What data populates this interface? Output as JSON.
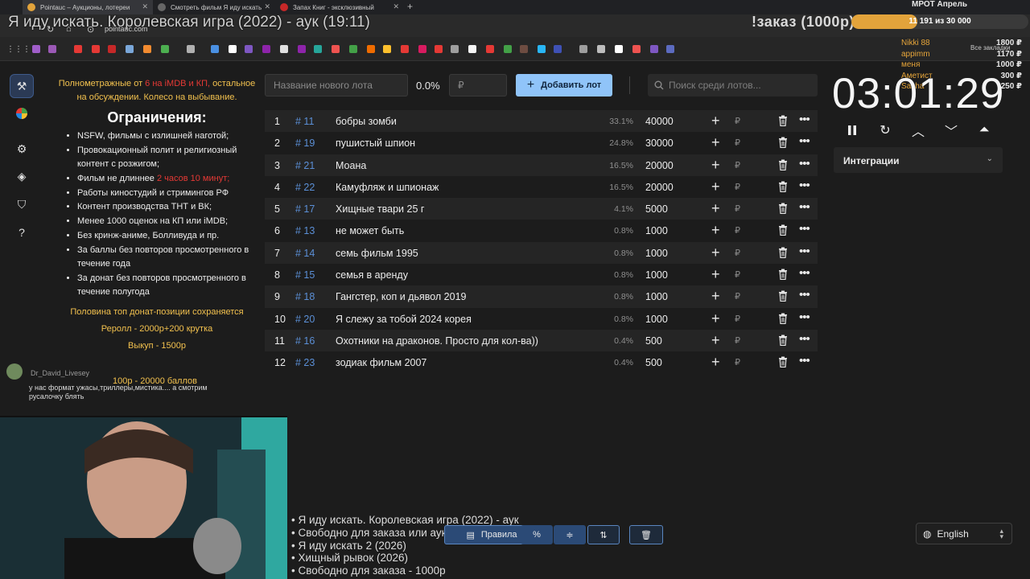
{
  "browser": {
    "tabs": [
      {
        "label": "Pointauc – Аукционы, лотереи",
        "favicon_color": "#e2a33b"
      },
      {
        "label": "Смотреть фильм Я иду искать",
        "favicon_color": "#666666"
      },
      {
        "label": "Запах Книг - эксклюзивный",
        "favicon_color": "#c62828"
      }
    ],
    "url": "pointauc.com",
    "all_bookmarks": "Все закладки"
  },
  "stream": {
    "title": "Я иду искать. Королевская игра (2022) - аук (19:11)",
    "order_label": "!заказ (1000р)",
    "goal_label": "МРОТ Апрель",
    "goal_text": "11 191  из 30 000",
    "goal_progress": 0.373,
    "donors": [
      {
        "name": "Nikki 88",
        "amount": "1800 ₽"
      },
      {
        "name": "appimm",
        "amount": "1170 ₽"
      },
      {
        "name": "меня",
        "amount": "1000 ₽"
      },
      {
        "name": "Аметист",
        "amount": "300 ₽"
      },
      {
        "name": "Sasha",
        "amount": "250 ₽"
      }
    ]
  },
  "info": {
    "intro_a": "Полнометражные от ",
    "intro_b": "6 на iMDB и КП,",
    "intro_c": " остальное на обсуждении. Колесо на выбывание.",
    "limits_title": "Ограничения:",
    "rules": [
      "NSFW, фильмы с излишней наготой;",
      "Провокационный полит и религиозный контент с розжигом;",
      "Фильм не длиннее ",
      "Работы киностудий и стримингов РФ",
      "Контент производства ТНТ и ВК;",
      "Менее 1000 оценок на КП или iMDB;",
      "Без кринж-аниме, Болливуда и пр.",
      "За баллы без повторов просмотренного в течение года",
      "За донат без повторов просмотренного в течение полугода"
    ],
    "rule_length_red": "2 часов 10 минут;",
    "notes": [
      "Половина топ донат-позиции сохраняется",
      "Реролл - 2000р+200 крутка",
      "Выкуп - 1500р"
    ],
    "bonus": "100р - 20000 баллов"
  },
  "chat": {
    "user": "Dr_David_Livesey",
    "message": "у нас формат ужасы,триллеры,мистика.... а смотрим русалочку блять"
  },
  "toolbar": {
    "new_lot_placeholder": "Название нового лота",
    "percent": "0.0%",
    "currency_placeholder": "₽",
    "add_label": "Добавить лот",
    "search_placeholder": "Поиск среди лотов..."
  },
  "lots": [
    {
      "idx": "1",
      "num": "# 11",
      "name": "бобры зомби",
      "pct": "33.1%",
      "amount": "40000"
    },
    {
      "idx": "2",
      "num": "# 19",
      "name": "пушистый шпион",
      "pct": "24.8%",
      "amount": "30000"
    },
    {
      "idx": "3",
      "num": "# 21",
      "name": "Моана",
      "pct": "16.5%",
      "amount": "20000"
    },
    {
      "idx": "4",
      "num": "# 22",
      "name": "Камуфляж и шпионаж",
      "pct": "16.5%",
      "amount": "20000"
    },
    {
      "idx": "5",
      "num": "# 17",
      "name": "Хищные твари 25 г",
      "pct": "4.1%",
      "amount": "5000"
    },
    {
      "idx": "6",
      "num": "# 13",
      "name": "не может быть",
      "pct": "0.8%",
      "amount": "1000"
    },
    {
      "idx": "7",
      "num": "# 14",
      "name": "семь фильм 1995",
      "pct": "0.8%",
      "amount": "1000"
    },
    {
      "idx": "8",
      "num": "# 15",
      "name": "семья в аренду",
      "pct": "0.8%",
      "amount": "1000"
    },
    {
      "idx": "9",
      "num": "# 18",
      "name": "Гангстер, коп и дьявол 2019",
      "pct": "0.8%",
      "amount": "1000"
    },
    {
      "idx": "10",
      "num": "# 20",
      "name": "Я слежу за тобой 2024  корея",
      "pct": "0.8%",
      "amount": "1000"
    },
    {
      "idx": "11",
      "num": "# 16",
      "name": "Охотники на драконов.  Просто для кол-ва))",
      "pct": "0.4%",
      "amount": "500"
    },
    {
      "idx": "12",
      "num": "# 23",
      "name": "зодиак фильм 2007",
      "pct": "0.4%",
      "amount": "500"
    }
  ],
  "lot_currency": "₽",
  "timer": {
    "value": "03:01:29"
  },
  "integrations": {
    "label": "Интеграции"
  },
  "queue": [
    "• Я иду искать. Королевская игра (2022) - аук",
    "• Свободно для заказа или аук",
    "• Я иду искать 2 (2026)",
    "• Хищный рывок (2026)",
    "• Свободно для заказа - 1000р"
  ],
  "bottom_toolbar": {
    "rules_label": "Правила"
  },
  "language": {
    "label": "English"
  },
  "colors": {
    "accent": "#90c4f9",
    "highlight": "#f2c14e",
    "warning": "#e53935",
    "lot_number": "#5b8fd6"
  }
}
